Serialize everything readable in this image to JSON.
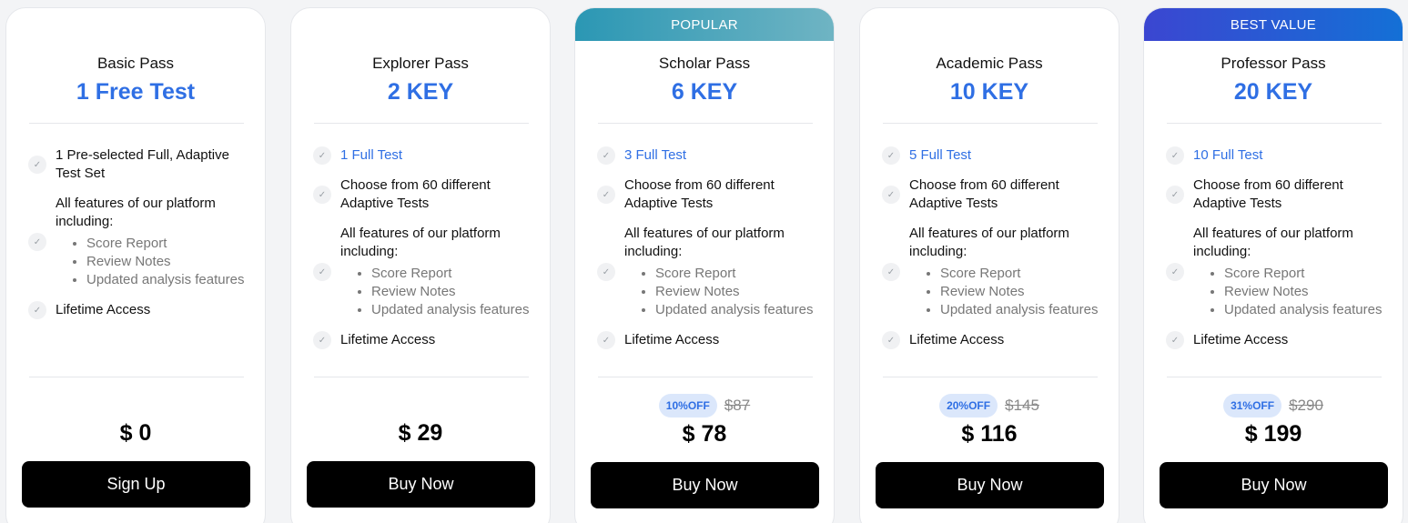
{
  "plans": [
    {
      "banner": "",
      "name": "Basic Pass",
      "qty": "1 Free Test",
      "features": [
        {
          "text": "1 Pre-selected Full, Adaptive Test Set",
          "blue": false
        },
        {
          "text": "All features of our platform including:",
          "blue": false,
          "sub": [
            "Score Report",
            "Review Notes",
            "Updated analysis features"
          ]
        },
        {
          "text": "Lifetime Access",
          "blue": false
        }
      ],
      "discount": "",
      "old_price": "",
      "price": "$ 0",
      "button": "Sign Up"
    },
    {
      "banner": "",
      "name": "Explorer Pass",
      "qty": "2 KEY",
      "features": [
        {
          "text": "1 Full Test",
          "blue": true
        },
        {
          "text": "Choose from 60 different Adaptive Tests",
          "blue": false
        },
        {
          "text": "All features of our platform including:",
          "blue": false,
          "sub": [
            "Score Report",
            "Review Notes",
            "Updated analysis features"
          ]
        },
        {
          "text": "Lifetime Access",
          "blue": false
        }
      ],
      "discount": "",
      "old_price": "",
      "price": "$ 29",
      "button": "Buy Now"
    },
    {
      "banner": "POPULAR",
      "name": "Scholar Pass",
      "qty": "6 KEY",
      "features": [
        {
          "text": "3 Full Test",
          "blue": true
        },
        {
          "text": "Choose from 60 different Adaptive Tests",
          "blue": false
        },
        {
          "text": "All features of our platform including:",
          "blue": false,
          "sub": [
            "Score Report",
            "Review Notes",
            "Updated analysis features"
          ]
        },
        {
          "text": "Lifetime Access",
          "blue": false
        }
      ],
      "discount": "10%OFF",
      "old_price": "$87",
      "price": "$ 78",
      "button": "Buy Now"
    },
    {
      "banner": "",
      "name": "Academic Pass",
      "qty": "10 KEY",
      "features": [
        {
          "text": "5 Full Test",
          "blue": true
        },
        {
          "text": "Choose from 60 different Adaptive Tests",
          "blue": false
        },
        {
          "text": "All features of our platform including:",
          "blue": false,
          "sub": [
            "Score Report",
            "Review Notes",
            "Updated analysis features"
          ]
        },
        {
          "text": "Lifetime Access",
          "blue": false
        }
      ],
      "discount": "20%OFF",
      "old_price": "$145",
      "price": "$ 116",
      "button": "Buy Now"
    },
    {
      "banner": "BEST VALUE",
      "name": "Professor Pass",
      "qty": "20 KEY",
      "features": [
        {
          "text": "10 Full Test",
          "blue": true
        },
        {
          "text": "Choose from 60 different Adaptive Tests",
          "blue": false
        },
        {
          "text": "All features of our platform including:",
          "blue": false,
          "sub": [
            "Score Report",
            "Review Notes",
            "Updated analysis features"
          ]
        },
        {
          "text": "Lifetime Access",
          "blue": false
        }
      ],
      "discount": "31%OFF",
      "old_price": "$290",
      "price": "$ 199",
      "button": "Buy Now"
    }
  ],
  "colors": {
    "accent_blue": "#2f6fe4",
    "button_bg": "#000000",
    "popular_banner": "#2b97b4",
    "best_value_banner": "#3b46d1"
  },
  "icons": {
    "feature_check": "check-icon"
  }
}
